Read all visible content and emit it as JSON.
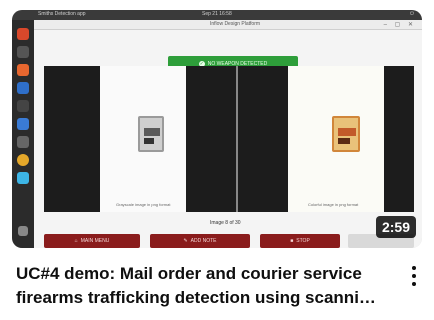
{
  "video": {
    "duration": "2:59",
    "title_line1": "UC#4 demo: Mail order and courier service",
    "title_line2": "firearms trafficking detection using scanni…"
  },
  "desktop": {
    "top_left": "Smiths Detection app",
    "top_center": "Sep 21 16:58",
    "top_right": "⏻",
    "window_title": "Inflow Design Platform",
    "window_controls": "– ▢ ✕"
  },
  "app": {
    "status_banner": "NO WEAPON DETECTED",
    "left_caption": "Grayscale image in png format",
    "right_caption": "Colorful image in png format",
    "counter": "Image 8 of 30",
    "buttons": {
      "main_menu": "MAIN MENU",
      "add_note": "ADD NOTE",
      "stop": "STOP",
      "blank": ""
    }
  },
  "colors": {
    "banner_green": "#2e9e3a",
    "button_red": "#8a1c1c",
    "duration_bg": "#000000"
  },
  "icons": [
    "home-icon",
    "pencil-icon",
    "stop-square-icon",
    "check-circle-icon",
    "kebab-menu-icon"
  ]
}
